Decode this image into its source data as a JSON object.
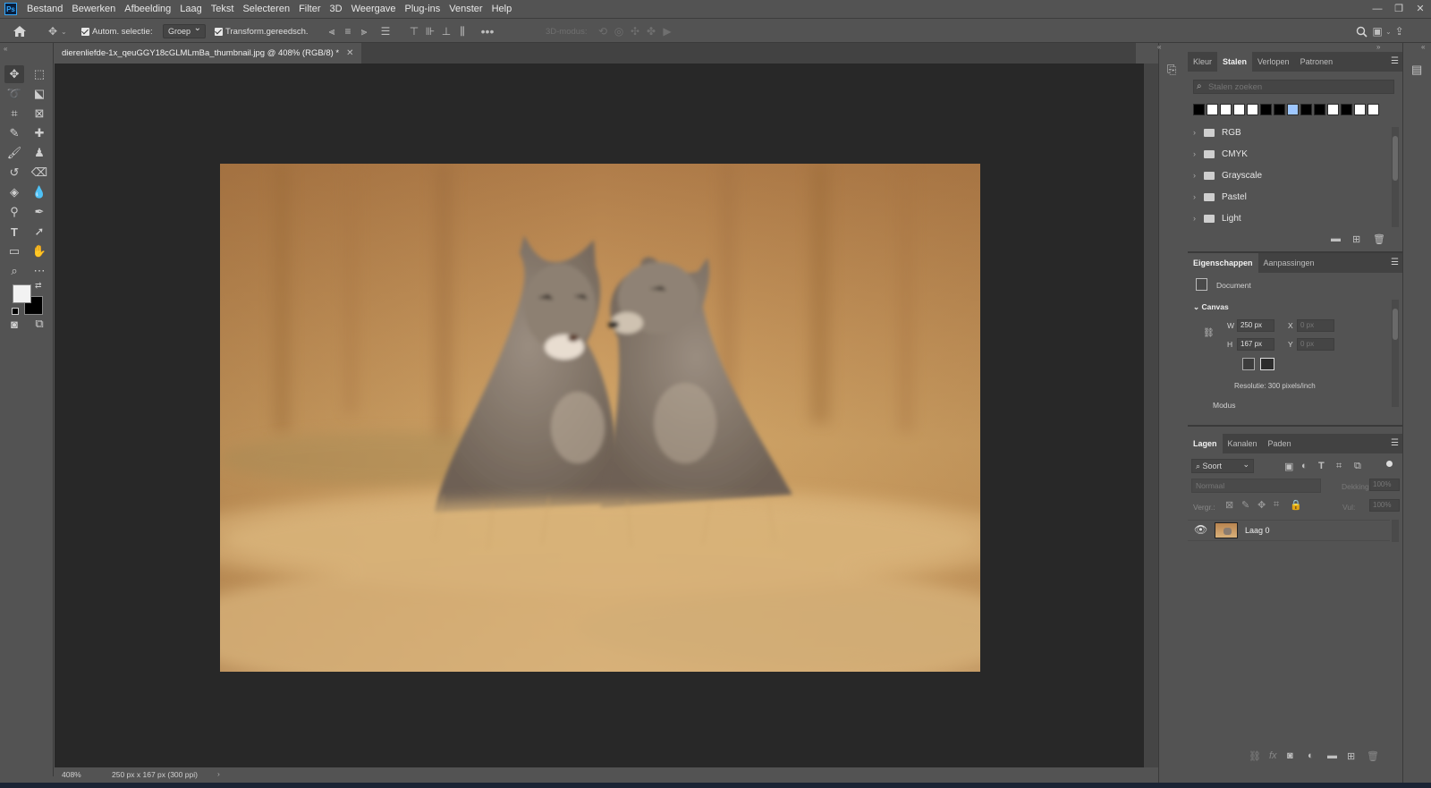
{
  "menu": [
    "Bestand",
    "Bewerken",
    "Afbeelding",
    "Laag",
    "Tekst",
    "Selecteren",
    "Filter",
    "3D",
    "Weergave",
    "Plug-ins",
    "Venster",
    "Help"
  ],
  "app_logo": "Ps",
  "options": {
    "auto_select_label": "Autom. selectie:",
    "auto_select_value": "Groep",
    "transform_label": "Transform.gereedsch.",
    "mode_3d_label": "3D-modus:"
  },
  "document": {
    "tab_title": "dierenliefde-1x_qeuGGY18cGLMLmBa_thumbnail.jpg @ 408% (RGB/8) *",
    "zoom": "408%",
    "status_info": "250 px x 167 px (300 ppi)"
  },
  "swatches_panel": {
    "tabs": [
      "Kleur",
      "Stalen",
      "Verlopen",
      "Patronen"
    ],
    "active_tab": "Stalen",
    "search_placeholder": "Stalen zoeken",
    "swatch_colors": [
      "#000000",
      "#ffffff",
      "#ffffff",
      "#ffffff",
      "#ffffff",
      "#000000",
      "#000000",
      "#9ec7ff",
      "#000000",
      "#000000",
      "#ffffff",
      "#000000",
      "#ffffff",
      "#ffffff"
    ],
    "groups": [
      "RGB",
      "CMYK",
      "Grayscale",
      "Pastel",
      "Light"
    ]
  },
  "properties_panel": {
    "tabs": [
      "Eigenschappen",
      "Aanpassingen"
    ],
    "active_tab": "Eigenschappen",
    "doc_label": "Document",
    "canvas_section": "Canvas",
    "w_label": "W",
    "w_value": "250 px",
    "h_label": "H",
    "h_value": "167 px",
    "x_label": "X",
    "x_value": "0 px",
    "y_label": "Y",
    "y_value": "0 px",
    "resolution": "Resolutie: 300 pixels/inch",
    "mode_label": "Modus"
  },
  "layers_panel": {
    "tabs": [
      "Lagen",
      "Kanalen",
      "Paden"
    ],
    "active_tab": "Lagen",
    "filter_label": "Soort",
    "blend_mode": "Normaal",
    "opacity_label": "Dekking:",
    "opacity_value": "100%",
    "lock_label": "Vergr.:",
    "fill_label": "Vul:",
    "fill_value": "100%",
    "layers": [
      {
        "name": "Laag 0",
        "visible": true
      }
    ]
  },
  "colors": {
    "foreground": "#f2f2f2",
    "background": "#000000",
    "accent": "#31a8ff"
  }
}
